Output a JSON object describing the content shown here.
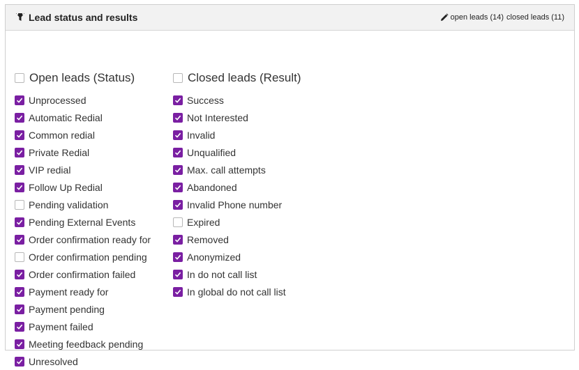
{
  "header": {
    "title": "Lead status and results",
    "open_link": "open leads (14)",
    "closed_link": "closed leads (11)"
  },
  "colors": {
    "accent": "#7a1fa2",
    "header_bg": "#f2f2f2",
    "text": "#333333"
  },
  "open_leads": {
    "title": "Open leads (Status)",
    "all_checked": false,
    "items": [
      {
        "label": "Unprocessed",
        "checked": true
      },
      {
        "label": "Automatic Redial",
        "checked": true
      },
      {
        "label": "Common redial",
        "checked": true
      },
      {
        "label": "Private Redial",
        "checked": true
      },
      {
        "label": "VIP redial",
        "checked": true
      },
      {
        "label": "Follow Up Redial",
        "checked": true
      },
      {
        "label": "Pending validation",
        "checked": false
      },
      {
        "label": "Pending External Events",
        "checked": true
      },
      {
        "label": "Order confirmation ready for",
        "checked": true
      },
      {
        "label": "Order confirmation pending",
        "checked": false
      },
      {
        "label": "Order confirmation failed",
        "checked": true
      },
      {
        "label": "Payment ready for",
        "checked": true
      },
      {
        "label": "Payment pending",
        "checked": true
      },
      {
        "label": "Payment failed",
        "checked": true
      },
      {
        "label": "Meeting feedback pending",
        "checked": true
      },
      {
        "label": "Unresolved",
        "checked": true
      }
    ]
  },
  "closed_leads": {
    "title": "Closed leads (Result)",
    "all_checked": false,
    "items": [
      {
        "label": "Success",
        "checked": true
      },
      {
        "label": "Not Interested",
        "checked": true
      },
      {
        "label": "Invalid",
        "checked": true
      },
      {
        "label": "Unqualified",
        "checked": true
      },
      {
        "label": "Max. call attempts",
        "checked": true
      },
      {
        "label": "Abandoned",
        "checked": true
      },
      {
        "label": "Invalid Phone number",
        "checked": true
      },
      {
        "label": "Expired",
        "checked": false
      },
      {
        "label": "Removed",
        "checked": true
      },
      {
        "label": "Anonymized",
        "checked": true
      },
      {
        "label": "In do not call list",
        "checked": true
      },
      {
        "label": "In global do not call list",
        "checked": true
      }
    ]
  }
}
